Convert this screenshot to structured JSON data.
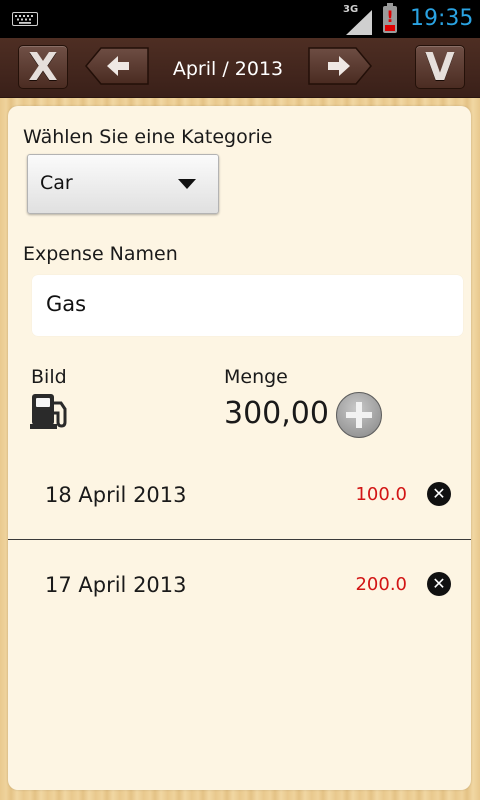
{
  "status_bar": {
    "network_label": "3G",
    "time": "19:35",
    "battery_alert": "!"
  },
  "toolbar": {
    "cancel_label": "X",
    "confirm_label": "V",
    "month_title": "April / 2013",
    "prev_icon": "arrow-left-icon",
    "next_icon": "arrow-right-icon"
  },
  "form": {
    "category_label": "Wählen Sie eine Kategorie",
    "category_value": "Car",
    "name_label": "Expense Namen",
    "name_value": "Gas",
    "image_label": "Bild",
    "image_icon": "fuel-pump-icon",
    "amount_label": "Menge",
    "amount_value": "300,00"
  },
  "entries": [
    {
      "date": "18 April 2013",
      "amount": "100.0"
    },
    {
      "date": "17 April 2013",
      "amount": "200.0"
    }
  ],
  "colors": {
    "toolbar": "#3f231b",
    "panel": "#fdf5e3",
    "amount_red": "#d21515",
    "clock_blue": "#2aa3e2"
  }
}
